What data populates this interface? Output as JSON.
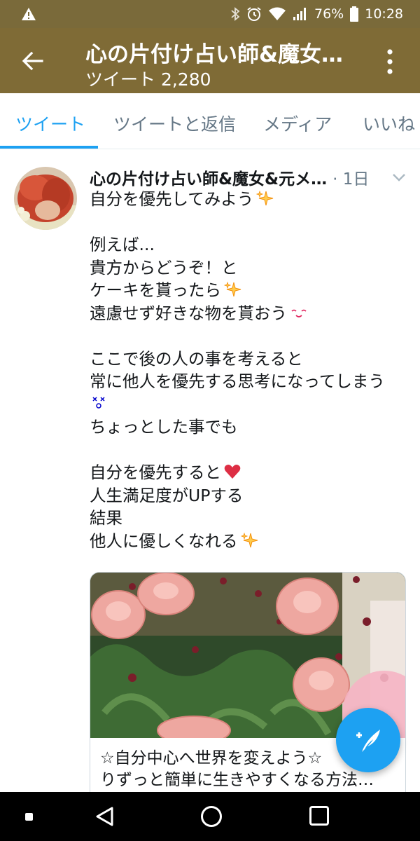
{
  "status_bar": {
    "battery": "76%",
    "time": "10:28",
    "icons": [
      "warning-icon",
      "bluetooth-icon",
      "alarm-icon",
      "wifi-icon",
      "signal-icon",
      "battery-icon"
    ]
  },
  "header": {
    "title": "心の片付け占い師&魔女…",
    "subtitle": "ツイート 2,280",
    "background": "#7f6b36"
  },
  "tabs": [
    {
      "label": "ツイート",
      "active": true
    },
    {
      "label": "ツイートと返信",
      "active": false
    },
    {
      "label": "メディア",
      "active": false
    },
    {
      "label": "いいね",
      "active": false
    }
  ],
  "tweet": {
    "author": "心の片付け占い師&魔女&元メ…",
    "time": "· 1日",
    "lines": [
      "自分を優先してみよう",
      "",
      "例えば...",
      "貴方からどうぞ！と",
      "ケーキを貰ったら",
      "遠慮せず好きな物を貰おう",
      "",
      "ここで後の人の事を考えると",
      "常に他人を優先する思考になってしまう",
      "",
      "ちょっとした事でも",
      "",
      "自分を優先すると",
      "人生満足度がUPする",
      "結果",
      "他人に優しくなれる"
    ],
    "card": {
      "title_line1": "☆自分中心へ世界を変えよう☆",
      "title_line2": "りずっと簡単に生きやすくなる方法…"
    }
  },
  "colors": {
    "accent": "#1da1f2",
    "status_bar": "#7a6a3a",
    "heart": "#e0245e"
  }
}
